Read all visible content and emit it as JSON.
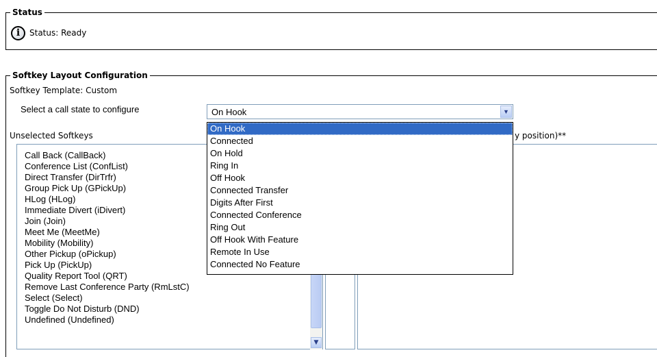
{
  "status": {
    "legend": "Status",
    "text": "Status: Ready",
    "icon": "info-icon"
  },
  "softkey_layout": {
    "legend": "Softkey Layout Configuration",
    "template_text": "Softkey Template: Custom",
    "select_label": "Select a call state to configure",
    "selected_value": "On Hook",
    "unselected_label": "Unselected Softkeys",
    "selected_label_tail": "y position)**",
    "unselected_items": [
      "Call Back (CallBack)",
      "Conference List (ConfList)",
      "Direct Transfer (DirTrfr)",
      "Group Pick Up (GPickUp)",
      "HLog (HLog)",
      "Immediate Divert (iDivert)",
      "Join (Join)",
      "Meet Me (MeetMe)",
      "Mobility (Mobility)",
      "Other Pickup (oPickup)",
      "Pick Up (PickUp)",
      "Quality Report Tool (QRT)",
      "Remove Last Conference Party (RmLstC)",
      "Select (Select)",
      "Toggle Do Not Disturb (DND)",
      "Undefined (Undefined)"
    ],
    "dropdown_options": [
      "On Hook",
      "Connected",
      "On Hold",
      "Ring In",
      "Off Hook",
      "Connected Transfer",
      "Digits After First",
      "Connected Conference",
      "Ring Out",
      "Off Hook With Feature",
      "Remote In Use",
      "Connected No Feature"
    ]
  },
  "colors": {
    "selection": "#316ac5",
    "control_border": "#7f9db9"
  }
}
